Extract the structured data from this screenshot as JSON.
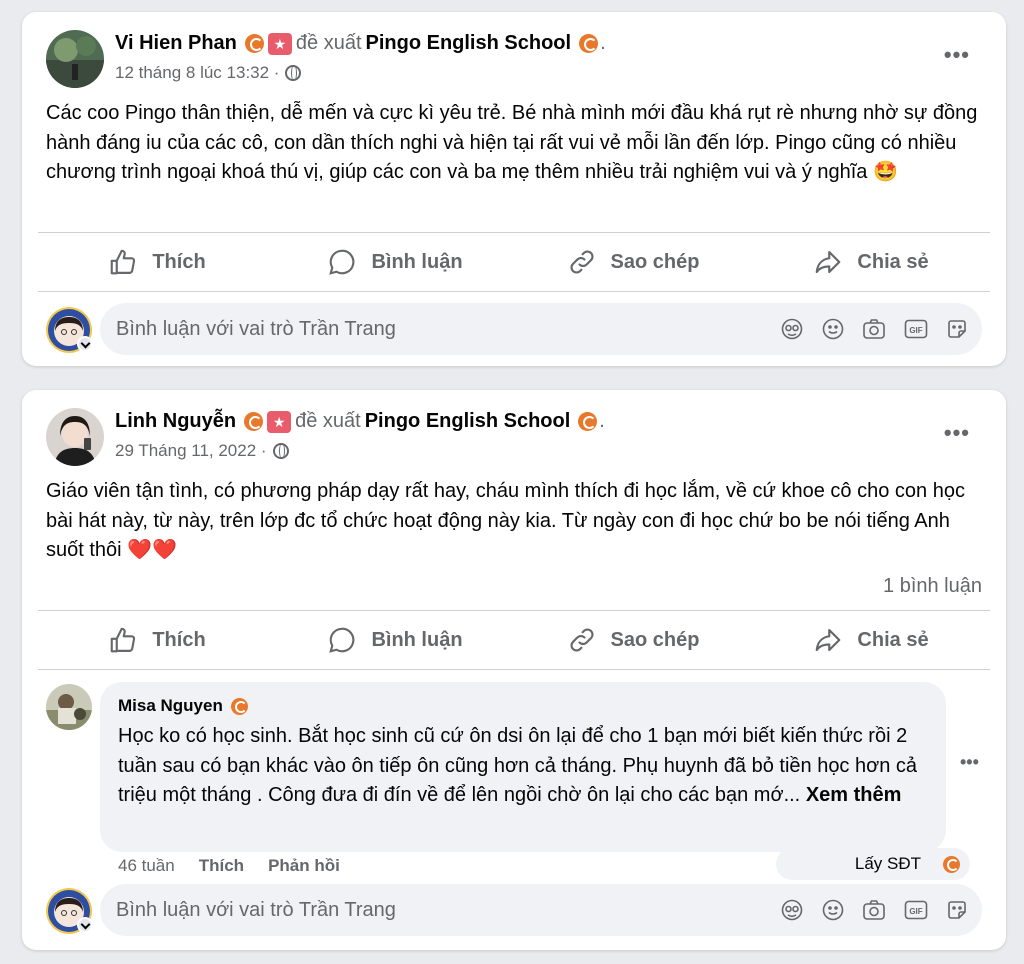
{
  "posts": [
    {
      "author": "Vi Hien Phan",
      "verb": "đề xuất",
      "page": "Pingo English School",
      "timestamp": "12 tháng 8 lúc 13:32 ·",
      "text": "Các coo Pingo thân thiện, dễ mến và cực kì yêu trẻ. Bé nhà mình mới đầu khá rụt rè nhưng nhờ sự đồng hành đáng iu của các cô, con dần thích nghi và hiện tại rất vui vẻ mỗi lần đến lớp. Pingo cũng có nhiều chương trình ngoại khoá thú vị, giúp các con và ba mẹ thêm nhiều trải nghiệm vui và ý nghĩa 🤩"
    },
    {
      "author": "Linh Nguyễn",
      "verb": "đề xuất",
      "page": "Pingo English School",
      "timestamp": "29 Tháng 11, 2022 ·",
      "text": "Giáo viên tận tình, có phương pháp dạy rất hay, cháu mình thích đi học lắm, về cứ khoe cô cho con học bài hát này, từ này, trên lớp đc tổ chức hoạt động này kia. Từ ngày con đi học chứ bo be nói tiếng Anh suốt thôi ❤️❤️",
      "comment_count": "1 bình luận"
    }
  ],
  "actions": {
    "like": "Thích",
    "comment": "Bình luận",
    "copy": "Sao chép",
    "share": "Chia sẻ"
  },
  "comment_placeholder": "Bình luận với vai trò Trần Trang",
  "more_label": "•••",
  "reply": {
    "author": "Misa Nguyen",
    "text": "Học ko có học sinh. Bắt học sinh cũ cứ ôn dsi ôn lại để cho 1 bạn mới biết kiến thức rồi 2 tuần sau có bạn khác vào ôn tiếp ôn cũng hơn cả tháng. Phụ huynh đã bỏ tiền học hơn cả triệu một tháng . Công đưa đi đín về để lên ngồi chờ ôn lại cho các bạn mớ...",
    "see_more": "Xem thêm",
    "age": "46 tuần",
    "like": "Thích",
    "reply_label": "Phản hồi",
    "pill_text": "Lấy SĐT"
  },
  "colors": {
    "background": "#e9ebee",
    "card": "#ffffff",
    "secondary_text": "#65676b",
    "badge_orange": "#e8782b",
    "input_bg": "#f0f2f5"
  },
  "icons": [
    "thumb-up-icon",
    "comment-bubble-icon",
    "link-icon",
    "share-arrow-icon",
    "avatar-sticker-icon",
    "emoji-icon",
    "camera-icon",
    "gif-icon",
    "sticker-icon",
    "globe-icon",
    "more-icon"
  ]
}
